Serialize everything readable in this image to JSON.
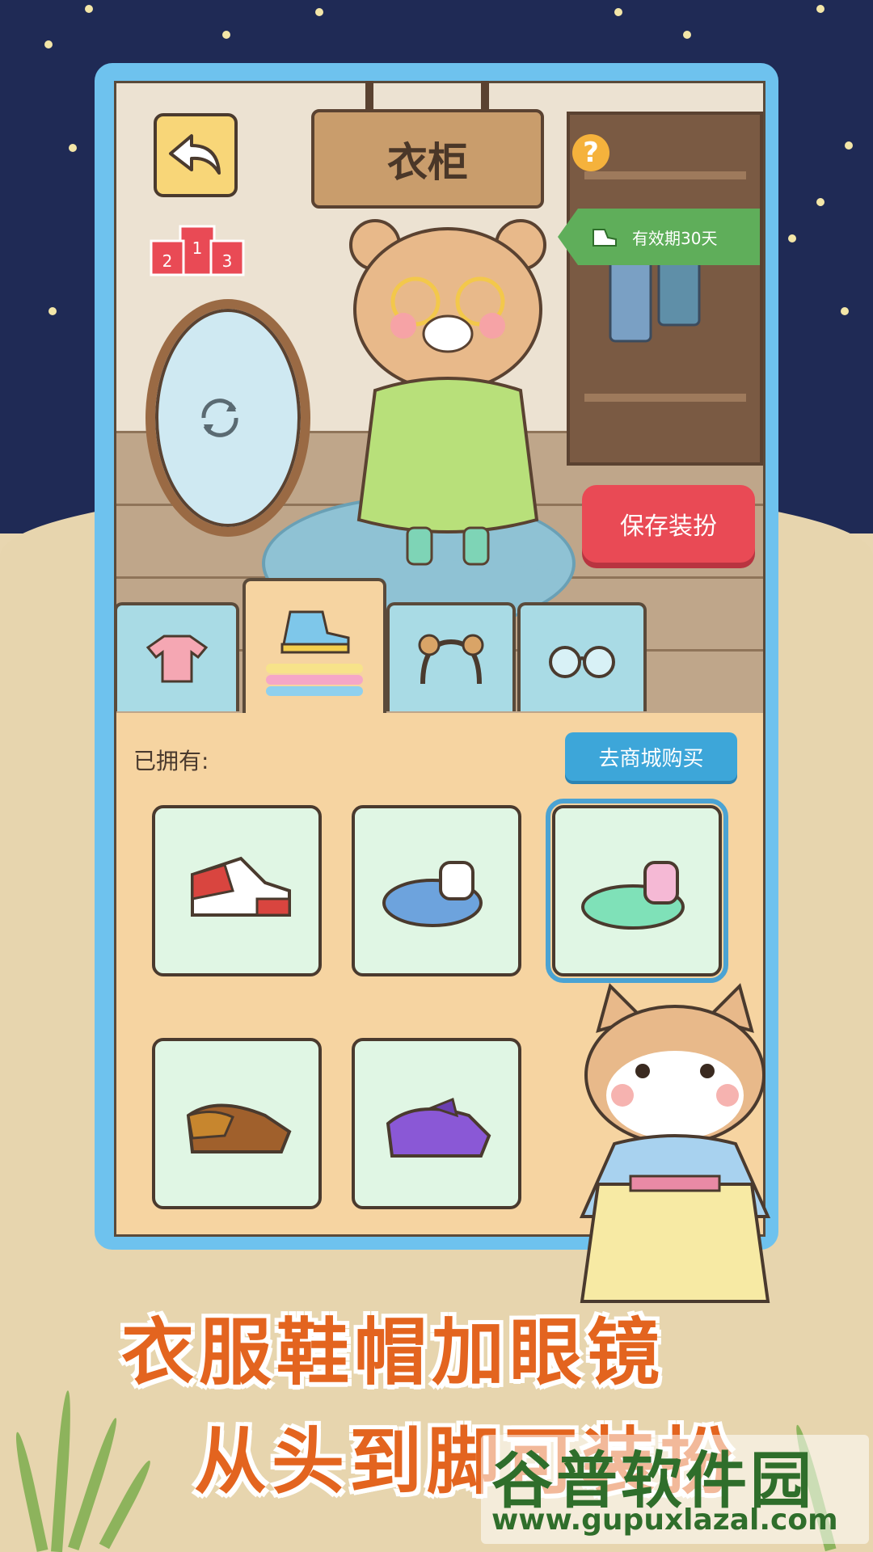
{
  "room": {
    "sign_title": "衣柜",
    "help_symbol": "?",
    "podium": {
      "first": "1",
      "second": "2",
      "third": "3"
    },
    "validity_label": "有效期30天",
    "save_button": "保存装扮"
  },
  "tabs": [
    {
      "name": "clothes",
      "active": false
    },
    {
      "name": "shoes",
      "active": true
    },
    {
      "name": "headwear",
      "active": false
    },
    {
      "name": "glasses",
      "active": false
    }
  ],
  "panel": {
    "owned_label": "已拥有:",
    "shop_button": "去商城购买",
    "items": [
      {
        "name": "red-sneakers",
        "selected": false
      },
      {
        "name": "blue-slippers",
        "selected": false
      },
      {
        "name": "green-shoes",
        "selected": true
      },
      {
        "name": "brown-shoes",
        "selected": false
      },
      {
        "name": "purple-shoes",
        "selected": false
      }
    ]
  },
  "caption": {
    "line1": "衣服鞋帽加眼镜",
    "line2": "从头到脚可装扮"
  },
  "watermark": {
    "title": "谷普软件园",
    "url": "www.gupuxlazal.com"
  },
  "colors": {
    "sky": "#1f2a55",
    "frame": "#6ec2ee",
    "save": "#e94a55",
    "shop": "#3da6d9",
    "caption": "#e3641f"
  }
}
